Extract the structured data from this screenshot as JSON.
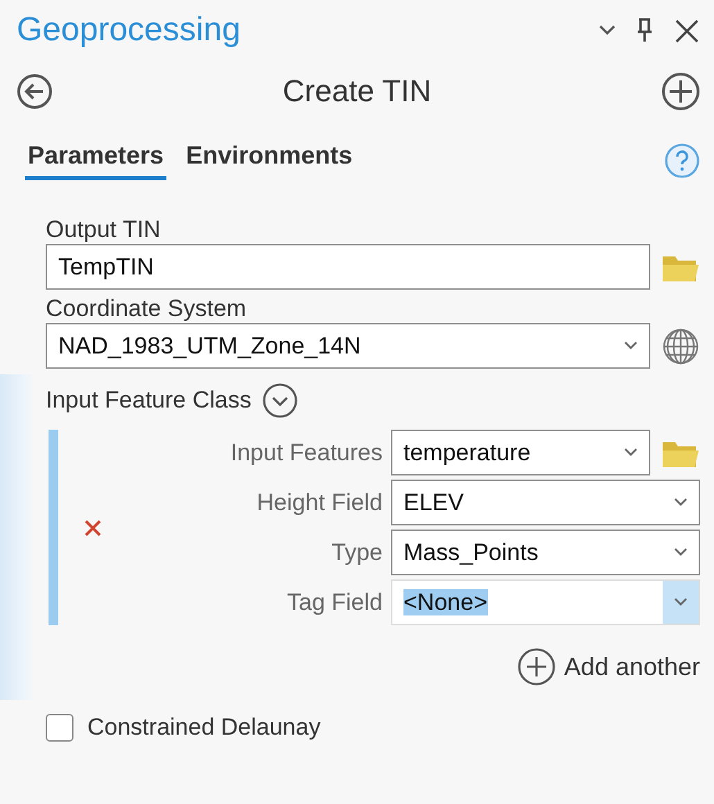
{
  "panel": {
    "title": "Geoprocessing"
  },
  "tool": {
    "title": "Create TIN"
  },
  "tabs": [
    {
      "label": "Parameters",
      "selected": true
    },
    {
      "label": "Environments",
      "selected": false
    }
  ],
  "output_tin": {
    "label": "Output TIN",
    "value": "TempTIN"
  },
  "coordinate_system": {
    "label": "Coordinate System",
    "value": "NAD_1983_UTM_Zone_14N"
  },
  "input_feature_class": {
    "label": "Input Feature Class",
    "expanded": true,
    "rows": [
      {
        "label": "Input Features",
        "value": "temperature",
        "kind": "browse",
        "selected": false
      },
      {
        "label": "Height Field",
        "value": "ELEV",
        "kind": "dropdown",
        "selected": false
      },
      {
        "label": "Type",
        "value": "Mass_Points",
        "kind": "dropdown",
        "selected": false
      },
      {
        "label": "Tag Field",
        "value": "<None>",
        "kind": "dropdown",
        "selected": true
      }
    ],
    "add_label": "Add another"
  },
  "constrained_delaunay": {
    "label": "Constrained Delaunay",
    "checked": false
  }
}
